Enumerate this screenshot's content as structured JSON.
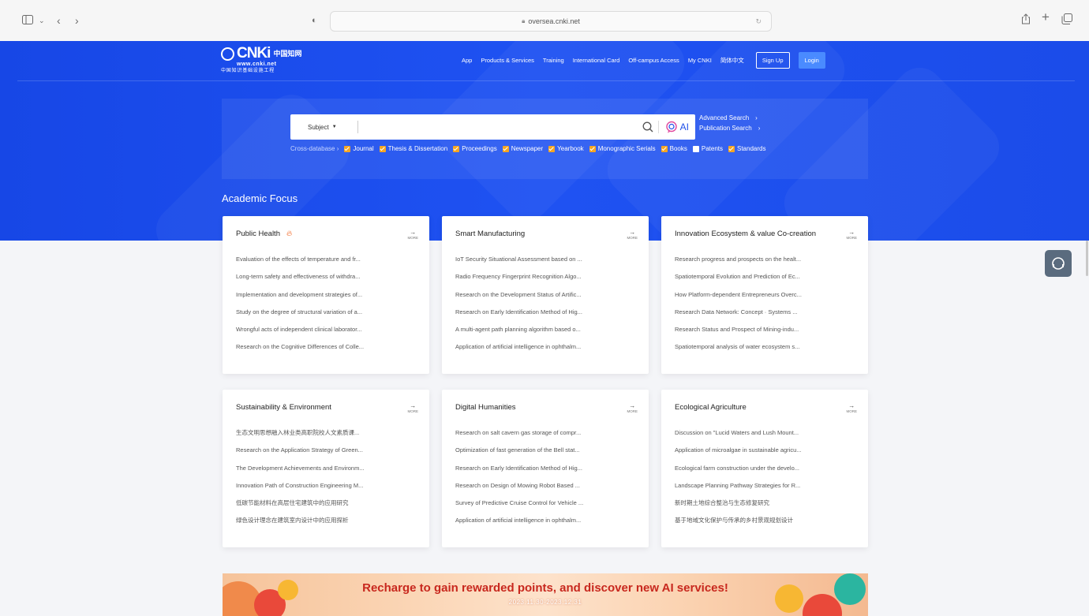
{
  "browser": {
    "url": "oversea.cnki.net"
  },
  "logo": {
    "main": "CNKi",
    "cn": "中国知网",
    "url": "www.cnki.net",
    "sub": "中国知识基础设施工程"
  },
  "nav": {
    "items": [
      "App",
      "Products & Services",
      "Training",
      "International Card",
      "Off-campus Access",
      "My CNKI",
      "简体中文"
    ],
    "signup": "Sign Up",
    "login": "Login"
  },
  "search": {
    "subject": "Subject",
    "ai_label": "AI",
    "advanced": "Advanced Search",
    "publication": "Publication Search",
    "cross_database": "Cross-database",
    "databases": [
      {
        "label": "Journal",
        "checked": true
      },
      {
        "label": "Thesis & Dissertation",
        "checked": true
      },
      {
        "label": "Proceedings",
        "checked": true
      },
      {
        "label": "Newspaper",
        "checked": true
      },
      {
        "label": "Yearbook",
        "checked": true
      },
      {
        "label": "Monographic Serials",
        "checked": true
      },
      {
        "label": "Books",
        "checked": true
      },
      {
        "label": "Patents",
        "checked": false
      },
      {
        "label": "Standards",
        "checked": true
      }
    ]
  },
  "focus": {
    "title": "Academic Focus",
    "more_label": "MORE",
    "cards": [
      {
        "title": "Public Health",
        "hot": true,
        "items": [
          "Evaluation of the effects of temperature and fr...",
          "Long-term safety and effectiveness of withdra...",
          "Implementation and development strategies of...",
          "Study on the degree of structural variation of a...",
          "Wrongful acts of independent clinical laborator...",
          "Research on the Cognitive Differences of Colle..."
        ]
      },
      {
        "title": "Smart Manufacturing",
        "hot": false,
        "items": [
          "IoT Security Situational Assessment based on ...",
          "Radio Frequency Fingerprint Recognition Algo...",
          "Research on the Development Status of Artific...",
          "Research on Early Identification Method of Hig...",
          "A multi-agent path planning algorithm based o...",
          "Application of artificial intelligence in ophthalm..."
        ]
      },
      {
        "title": "Innovation Ecosystem & value Co-creation",
        "hot": false,
        "items": [
          "Research progress and prospects on the healt...",
          "Spatiotemporal Evolution and Prediction of Ec...",
          "How Platform-dependent Entrepreneurs Overc...",
          "Research Data Network: Concept · Systems ...",
          "Research Status and Prospect of Mining-indu...",
          "Spatiotemporal analysis of water ecosystem s..."
        ]
      },
      {
        "title": "Sustainability & Environment",
        "hot": false,
        "items": [
          "生态文明思想融入林业类高职院校人文素质课...",
          "Research on the Application Strategy of Green...",
          "The Development Achievements and Environm...",
          "Innovation Path of Construction Engineering M...",
          "低碳节能材料在高层住宅建筑中的应用研究",
          "绿色设计理念在建筑室内设计中的应用探析"
        ]
      },
      {
        "title": "Digital Humanities",
        "hot": false,
        "items": [
          "Research on salt cavern gas storage of compr...",
          "Optimization of fast generation of the Bell stat...",
          "Research on Early Identification Method of Hig...",
          "Research on Design of Mowing Robot Based ...",
          "Survey of Predictive Cruise Control for Vehicle ...",
          "Application of artificial intelligence in ophthalm..."
        ]
      },
      {
        "title": "Ecological Agriculture",
        "hot": false,
        "items": [
          "Discussion on \"Lucid Waters and Lush Mount...",
          "Application of microalgae in sustainable agricu...",
          "Ecological farm construction under the develo...",
          "Landscape Planning Pathway Strategies for R...",
          "新时期土地综合整治与生态修复研究",
          "基于地域文化保护与传承的乡村景观规划设计"
        ]
      }
    ]
  },
  "banner": {
    "title": "Recharge to gain rewarded points, and discover new AI services!",
    "date": "2023.11.30-2023.12.31"
  },
  "colors": {
    "brand_blue": "#1f52f2",
    "check_orange": "#f5a623",
    "banner_red": "#c8281e"
  }
}
